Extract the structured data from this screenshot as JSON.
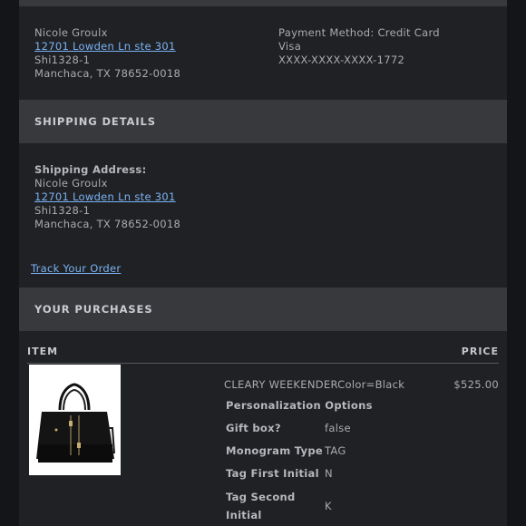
{
  "billing": {
    "name": "Nicole Groulx",
    "address_line1": "12701 Lowden Ln ste 301",
    "address_line2": "Shi1328-1",
    "city_line": "Manchaca, TX 78652-0018",
    "payment_method": "Payment Method: Credit Card",
    "card_type": "Visa",
    "card_number": "XXXX-XXXX-XXXX-1772"
  },
  "shipping": {
    "header": "SHIPPING DETAILS",
    "label": "Shipping Address:",
    "name": "Nicole Groulx",
    "address_line1": "12701 Lowden Ln ste 301",
    "address_line2": "Shi1328-1",
    "city_line": "Manchaca, TX 78652-0018"
  },
  "track_order_label": "Track Your Order",
  "purchases": {
    "header": "YOUR PURCHASES",
    "columns": {
      "item": "ITEM",
      "price": "PRICE"
    },
    "items": [
      {
        "title": "CLEARY WEEKENDERColor=Black",
        "price": "$525.00",
        "personalization_header": "Personalization Options",
        "options": [
          {
            "label": "Gift box?",
            "value": "false"
          },
          {
            "label": "Monogram Type",
            "value": "TAG"
          },
          {
            "label": "Tag First Initial",
            "value": "N"
          },
          {
            "label_line1": "Tag Second",
            "label_line2": "Initial",
            "value": "K"
          }
        ]
      }
    ]
  }
}
